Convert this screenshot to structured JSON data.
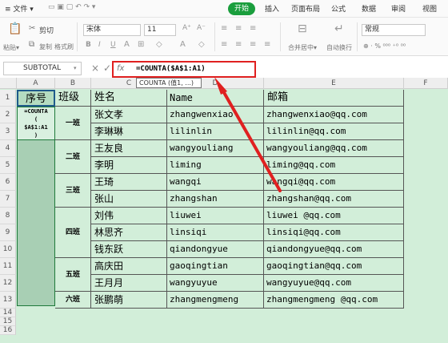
{
  "menubar": {
    "file": "≡ 文件 ▾",
    "items": [
      "开始",
      "插入",
      "页面布局",
      "公式",
      "数据",
      "审阅",
      "视图"
    ]
  },
  "toolbar": {
    "paste": "粘贴▾",
    "cut": "剪切",
    "copy": "复制",
    "format_painter": "格式刷",
    "font_name": "宋体",
    "font_size": "11",
    "merge_center": "合并居中▾",
    "wrap_text": "自动换行",
    "number_format": "常规",
    "bold": "B",
    "italic": "I",
    "underline": "U",
    "grow_font": "A⁺",
    "shrink_font": "A⁻",
    "percent_group": "⊕ · % ⁰⁰⁰ ⁺⁰ ⁰⁰"
  },
  "formula_bar": {
    "name_box": "SUBTOTAL",
    "cancel": "×",
    "confirm": "✓",
    "fx": "fx",
    "formula": "=COUNTA($A$1:A1)",
    "tooltip": "COUNTA (值1, ...)"
  },
  "columns": [
    "A",
    "B",
    "C",
    "D",
    "E",
    "F"
  ],
  "rows": [
    "1",
    "2",
    "3",
    "4",
    "5",
    "6",
    "7",
    "8",
    "9",
    "10",
    "11",
    "12",
    "13",
    "14",
    "15",
    "16"
  ],
  "header": {
    "seq": "序号",
    "class": "班级",
    "name": "姓名",
    "pinyin": "Name",
    "email": "邮箱"
  },
  "a2_lines": [
    "=COUNTA",
    "(",
    "$A$1:A1",
    ")"
  ],
  "classes": [
    "一班",
    "二班",
    "三班",
    "四班",
    "五班",
    "六班"
  ],
  "people": [
    {
      "name": "张文孝",
      "pinyin": "zhangwenxiao",
      "email": "zhangwenxiao@qq.com"
    },
    {
      "name": "李琳琳",
      "pinyin": "lilinlin",
      "email": "lilinlin@qq.com"
    },
    {
      "name": "王友良",
      "pinyin": "wangyouliang",
      "email": "wangyouliang@qq.com"
    },
    {
      "name": "李明",
      "pinyin": "liming",
      "email": "liming@qq.com"
    },
    {
      "name": "王琦",
      "pinyin": "wangqi",
      "email": "wangqi@qq.com"
    },
    {
      "name": "张山",
      "pinyin": "zhangshan",
      "email": "zhangshan@qq.com"
    },
    {
      "name": "刘伟",
      "pinyin": "liuwei",
      "email": "liuwei @qq.com"
    },
    {
      "name": "林思齐",
      "pinyin": "linsiqi",
      "email": "linsiqi@qq.com"
    },
    {
      "name": "钱东跃",
      "pinyin": "qiandongyue",
      "email": "qiandongyue@qq.com"
    },
    {
      "name": "高庆田",
      "pinyin": "gaoqingtian",
      "email": "gaoqingtian@qq.com"
    },
    {
      "name": "王月月",
      "pinyin": "wangyuyue",
      "email": "wangyuyue@qq.com"
    },
    {
      "name": "张鹏萌",
      "pinyin": "zhangmengmeng",
      "email": "zhangmengmeng @qq.com"
    }
  ],
  "colors": {
    "accent_green": "#1a9e3d",
    "highlight_red": "#e02020",
    "grid_green": "#d2eed9",
    "selection_green": "#a8cfb4"
  }
}
